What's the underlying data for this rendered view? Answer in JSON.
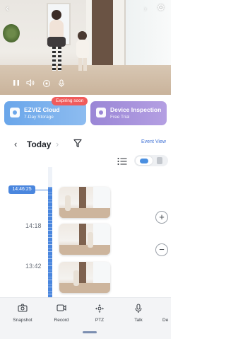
{
  "player": {
    "back_icon": "‹",
    "settings_icon": "⚙",
    "next_icon": "›",
    "controls": [
      "pause-icon",
      "volume-icon",
      "focus-icon",
      "microphone-icon"
    ]
  },
  "cards": {
    "cloud": {
      "title": "EZVIZ Cloud",
      "subtitle": "7-Day Storage",
      "badge": "Expiring soon"
    },
    "inspection": {
      "title": "Device Inspection",
      "subtitle": "Free Trial"
    }
  },
  "date_nav": {
    "label": "Today",
    "event_view": "Event View"
  },
  "timeline": {
    "current_time": "14:46:25",
    "ticks": [
      "14:18",
      "13:42"
    ]
  },
  "zoom": {
    "in": "+",
    "out": "−"
  },
  "toolbar": {
    "items": [
      {
        "label": "Snapshot",
        "icon": "camera-icon"
      },
      {
        "label": "Record",
        "icon": "video-record-icon"
      },
      {
        "label": "PTZ",
        "icon": "ptz-icon"
      },
      {
        "label": "Talk",
        "icon": "microphone-icon"
      },
      {
        "label": "De",
        "icon": "more-icon"
      }
    ]
  },
  "colors": {
    "accent": "#4a86de",
    "cloud_card": "#6aa6ea",
    "inspection_card": "#9a86d6",
    "badge": "#f05b5b"
  }
}
